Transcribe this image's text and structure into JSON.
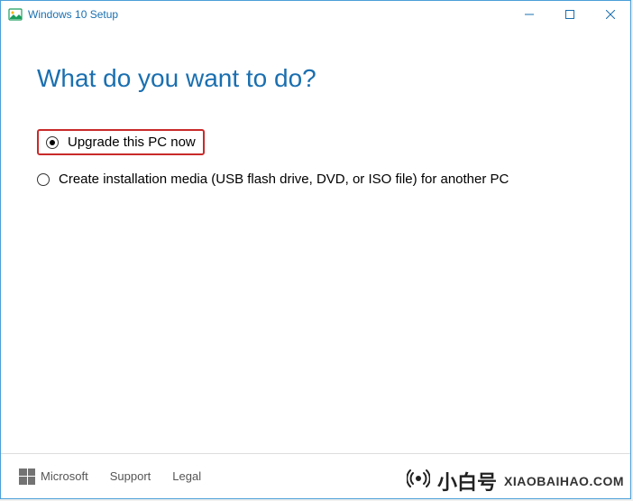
{
  "titlebar": {
    "title": "Windows 10 Setup"
  },
  "heading": "What do you want to do?",
  "options": {
    "upgrade": {
      "label": "Upgrade this PC now",
      "selected": true
    },
    "create_media": {
      "label": "Create installation media (USB flash drive, DVD, or ISO file) for another PC",
      "selected": false
    }
  },
  "footer": {
    "brand": "Microsoft",
    "support": "Support",
    "legal": "Legal"
  },
  "watermark": {
    "cn": "小白号",
    "en": "XIAOBAIHAO.COM"
  }
}
